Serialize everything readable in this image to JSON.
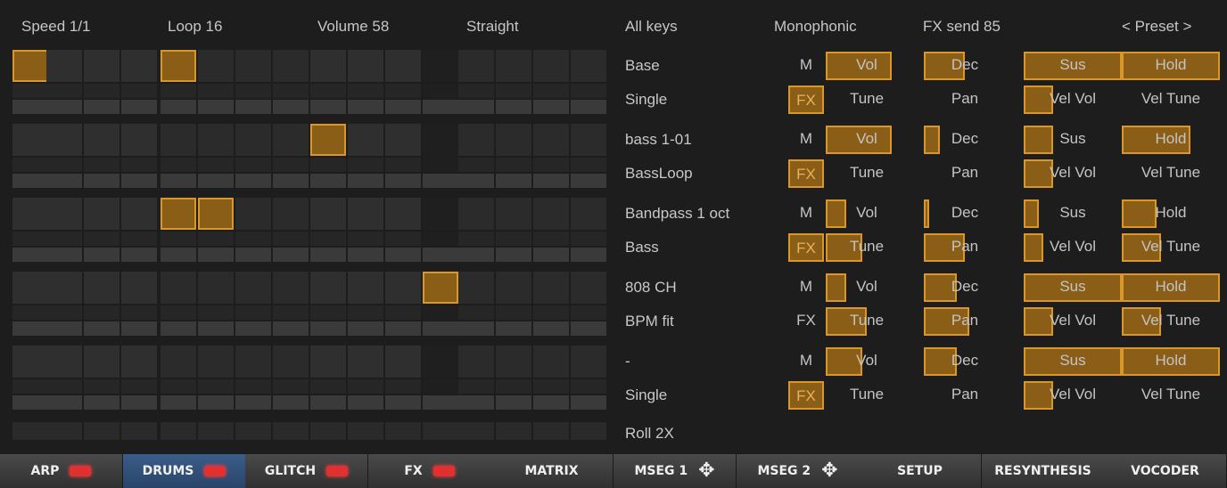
{
  "header": {
    "speed": "Speed 1/1",
    "loop": "Loop 16",
    "volume": "Volume 58",
    "feel": "Straight",
    "keys": "All keys",
    "mode": "Monophonic",
    "fx_send": "FX send 85",
    "preset": "< Preset >"
  },
  "step_grid": {
    "lanes": [
      {
        "active_steps": [
          1,
          5
        ]
      },
      {
        "active_steps": [
          9
        ]
      },
      {
        "active_steps": [
          5,
          6
        ]
      },
      {
        "active_steps": [
          12
        ]
      },
      {
        "active_steps": []
      }
    ]
  },
  "lanes": [
    {
      "name": "Base",
      "mode": "Single",
      "m": "M",
      "fx": "FX",
      "fx_on": true,
      "vol": "Vol",
      "dec": "Dec",
      "sus": "Sus",
      "hold": "Hold",
      "tune": "Tune",
      "pan": "Pan",
      "velvol": "Vel Vol",
      "veltune": "Vel Tune",
      "levels": {
        "vol": 0.8,
        "dec": 0.5,
        "sus": 1.0,
        "hold": 1.0,
        "tune": 0.0,
        "pan": 0.0,
        "velvol": 0.3,
        "veltune": 0.0
      }
    },
    {
      "name": "bass 1-01",
      "mode": "BassLoop",
      "m": "M",
      "fx": "FX",
      "fx_on": true,
      "vol": "Vol",
      "dec": "Dec",
      "sus": "Sus",
      "hold": "Hold",
      "tune": "Tune",
      "pan": "Pan",
      "velvol": "Vel Vol",
      "veltune": "Vel Tune",
      "levels": {
        "vol": 0.8,
        "dec": 0.2,
        "sus": 0.3,
        "hold": 0.7,
        "tune": 0.0,
        "pan": 0.0,
        "velvol": 0.3,
        "veltune": 0.0
      }
    },
    {
      "name": "Bandpass 1 oct",
      "mode": "Bass",
      "m": "M",
      "fx": "FX",
      "fx_on": true,
      "vol": "Vol",
      "dec": "Dec",
      "sus": "Sus",
      "hold": "Hold",
      "tune": "Tune",
      "pan": "Pan",
      "velvol": "Vel Vol",
      "veltune": "Vel Tune",
      "levels": {
        "vol": 0.25,
        "dec": 0.05,
        "sus": 0.15,
        "hold": 0.35,
        "tune": 0.45,
        "pan": 0.5,
        "velvol": 0.2,
        "veltune": 0.4
      }
    },
    {
      "name": "808 CH",
      "mode": "BPM fit",
      "m": "M",
      "fx": "FX",
      "fx_on": false,
      "vol": "Vol",
      "dec": "Dec",
      "sus": "Sus",
      "hold": "Hold",
      "tune": "Tune",
      "pan": "Pan",
      "velvol": "Vel Vol",
      "veltune": "Vel Tune",
      "levels": {
        "vol": 0.25,
        "dec": 0.4,
        "sus": 1.0,
        "hold": 1.0,
        "tune": 0.5,
        "pan": 0.55,
        "velvol": 0.3,
        "veltune": 0.4
      }
    },
    {
      "name": "-",
      "mode": "Single",
      "m": "M",
      "fx": "FX",
      "fx_on": true,
      "vol": "Vol",
      "dec": "Dec",
      "sus": "Sus",
      "hold": "Hold",
      "tune": "Tune",
      "pan": "Pan",
      "velvol": "Vel Vol",
      "veltune": "Vel Tune",
      "levels": {
        "vol": 0.45,
        "dec": 0.4,
        "sus": 1.0,
        "hold": 1.0,
        "tune": 0.0,
        "pan": 0.0,
        "velvol": 0.3,
        "veltune": 0.0
      }
    }
  ],
  "roll_label": "Roll 2X",
  "tabs": [
    {
      "label": "ARP",
      "led": true,
      "active": false
    },
    {
      "label": "DRUMS",
      "led": true,
      "active": true
    },
    {
      "label": "GLITCH",
      "led": true,
      "active": false
    },
    {
      "label": "FX",
      "led": true,
      "active": false
    },
    {
      "label": "MATRIX",
      "led": false,
      "active": false
    },
    {
      "label": "MSEG 1",
      "move": true,
      "active": false
    },
    {
      "label": "MSEG 2",
      "move": true,
      "active": false
    },
    {
      "label": "SETUP",
      "active": false
    },
    {
      "label": "RESYNTHESIS",
      "active": false
    },
    {
      "label": "VOCODER",
      "active": false
    }
  ],
  "colors": {
    "accent": "#d9962b",
    "accent_fill": "#8b5e18",
    "led": "#e03030",
    "active_tab": "#2f4d77"
  }
}
